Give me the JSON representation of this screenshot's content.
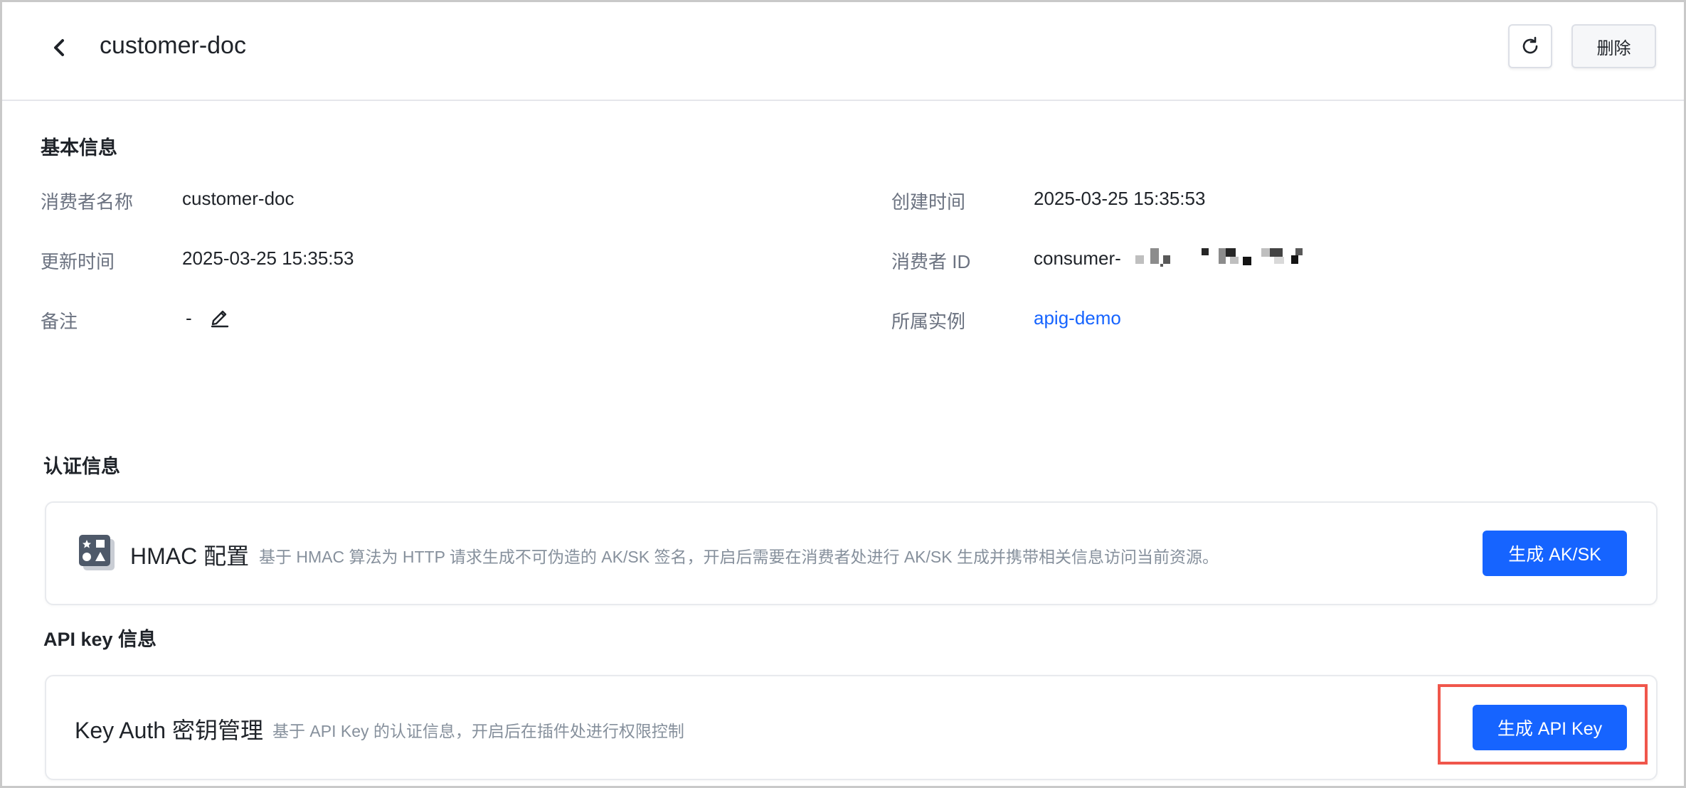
{
  "header": {
    "title": "customer-doc",
    "delete_label": "删除"
  },
  "basic_info": {
    "section_title": "基本信息",
    "fields": [
      {
        "label": "消费者名称",
        "value": "customer-doc"
      },
      {
        "label": "创建时间",
        "value": "2025-03-25 15:35:53"
      },
      {
        "label": "更新时间",
        "value": "2025-03-25 15:35:53"
      },
      {
        "label": "消费者 ID",
        "value": "consumer-"
      },
      {
        "label": "备注",
        "value": "-"
      },
      {
        "label": "所属实例",
        "value": "apig-demo"
      }
    ]
  },
  "auth_info": {
    "section_title": "认证信息",
    "hmac": {
      "title": "HMAC 配置",
      "description": "基于 HMAC 算法为 HTTP 请求生成不可伪造的 AK/SK 签名，开启后需要在消费者处进行 AK/SK 生成并携带相关信息访问当前资源。",
      "button_label": "生成 AK/SK"
    }
  },
  "api_key_info": {
    "section_title": "API key 信息",
    "key_auth": {
      "title": "Key Auth 密钥管理",
      "description": "基于 API Key 的认证信息，开启后在插件处进行权限控制",
      "button_label": "生成 API Key"
    }
  },
  "colors": {
    "primary": "#1664ff",
    "highlight": "#f0564b",
    "link": "#1664ff"
  },
  "icons": [
    "chevron-left-icon",
    "refresh-icon",
    "pencil-icon",
    "hmac-config-icon"
  ]
}
